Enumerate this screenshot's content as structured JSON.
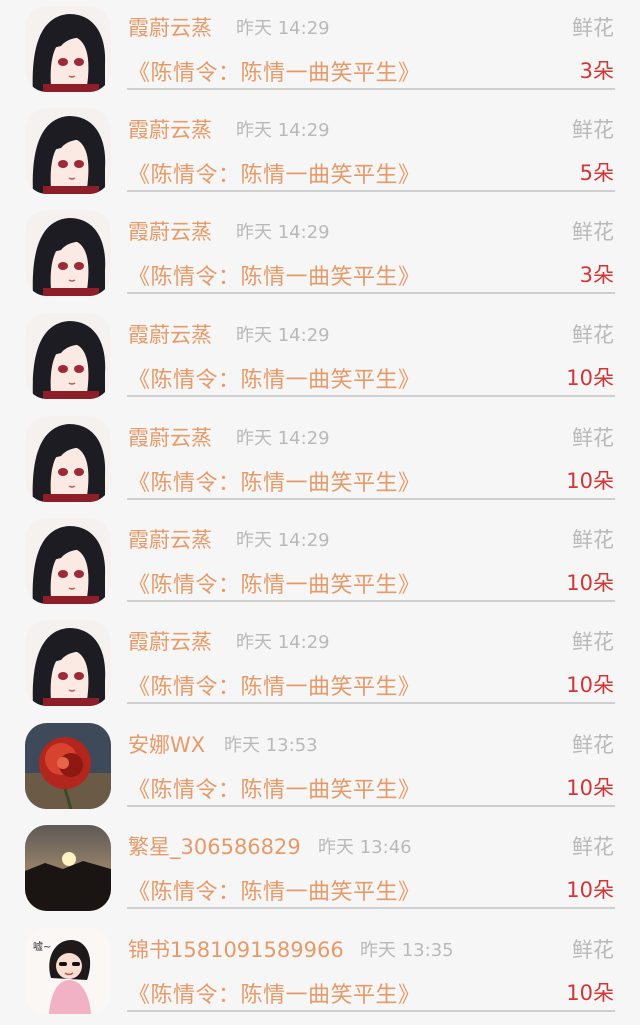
{
  "gift_list": {
    "items": [
      {
        "user": "霞蔚云蒸",
        "time": "昨天 14:29",
        "gift_type": "鲜花",
        "book": "《陈情令：陈情一曲笑平生》",
        "count": "3朵",
        "avatar": "anime-character-avatar"
      },
      {
        "user": "霞蔚云蒸",
        "time": "昨天 14:29",
        "gift_type": "鲜花",
        "book": "《陈情令：陈情一曲笑平生》",
        "count": "5朵",
        "avatar": "anime-character-avatar"
      },
      {
        "user": "霞蔚云蒸",
        "time": "昨天 14:29",
        "gift_type": "鲜花",
        "book": "《陈情令：陈情一曲笑平生》",
        "count": "3朵",
        "avatar": "anime-character-avatar"
      },
      {
        "user": "霞蔚云蒸",
        "time": "昨天 14:29",
        "gift_type": "鲜花",
        "book": "《陈情令：陈情一曲笑平生》",
        "count": "10朵",
        "avatar": "anime-character-avatar"
      },
      {
        "user": "霞蔚云蒸",
        "time": "昨天 14:29",
        "gift_type": "鲜花",
        "book": "《陈情令：陈情一曲笑平生》",
        "count": "10朵",
        "avatar": "anime-character-avatar"
      },
      {
        "user": "霞蔚云蒸",
        "time": "昨天 14:29",
        "gift_type": "鲜花",
        "book": "《陈情令：陈情一曲笑平生》",
        "count": "10朵",
        "avatar": "anime-character-avatar"
      },
      {
        "user": "霞蔚云蒸",
        "time": "昨天 14:29",
        "gift_type": "鲜花",
        "book": "《陈情令：陈情一曲笑平生》",
        "count": "10朵",
        "avatar": "anime-character-avatar"
      },
      {
        "user": "安娜WX",
        "time": "昨天 13:53",
        "gift_type": "鲜花",
        "book": "《陈情令：陈情一曲笑平生》",
        "count": "10朵",
        "avatar": "red-rose-avatar"
      },
      {
        "user": "繁星_306586829",
        "time": "昨天 13:46",
        "gift_type": "鲜花",
        "book": "《陈情令：陈情一曲笑平生》",
        "count": "10朵",
        "avatar": "sunset-avatar"
      },
      {
        "user": "锦书1581091589966",
        "time": "昨天 13:35",
        "gift_type": "鲜花",
        "book": "《陈情令：陈情一曲笑平生》",
        "count": "10朵",
        "avatar": "girl-cartoon-avatar"
      }
    ]
  },
  "colors": {
    "accent": "#e59a6a",
    "count": "#d13636",
    "muted": "#b9b9b9",
    "background": "#f7f6f6"
  }
}
